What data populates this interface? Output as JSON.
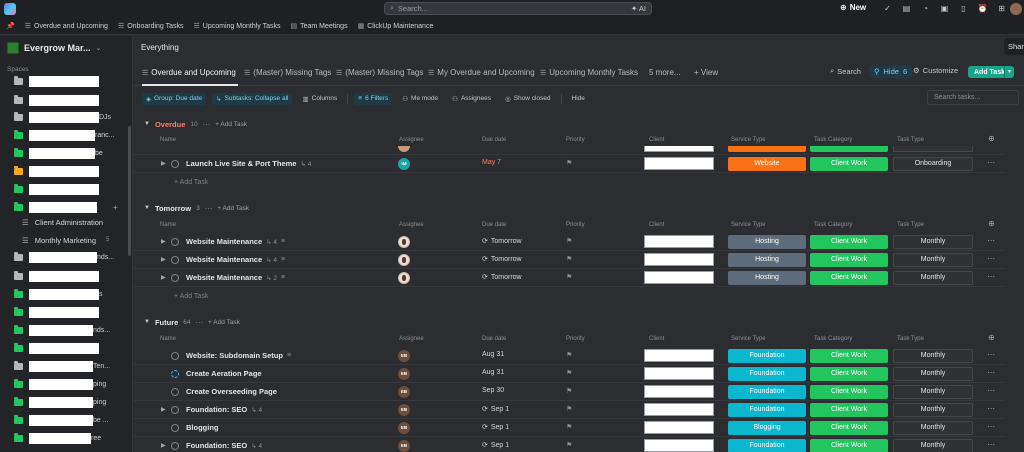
{
  "topbar": {
    "search_placeholder": "Search...",
    "ai_label": "AI",
    "new_label": "New"
  },
  "favorites": [
    {
      "label": "Overdue and Upcoming"
    },
    {
      "label": "Onboarding Tasks"
    },
    {
      "label": "Upcoming Monthly Tasks"
    },
    {
      "label": "Team Meetings"
    },
    {
      "label": "ClickUp Maintenance"
    }
  ],
  "sidebar": {
    "workspace_name": "Evergrow Mar...",
    "spaces_label": "Spaces",
    "items": [
      {
        "tail": ""
      },
      {
        "tail": ""
      },
      {
        "tail": "DJs"
      },
      {
        "tail": "ranc..."
      },
      {
        "tail": "be"
      },
      {
        "tail": ""
      },
      {
        "tail": ""
      },
      {
        "tail": ""
      }
    ],
    "subitems": [
      {
        "label": "Client Administration",
        "count": ""
      },
      {
        "label": "Monthly Marketing",
        "count": "5"
      }
    ],
    "items2": [
      {
        "tail": "nds..."
      },
      {
        "tail": ""
      },
      {
        "tail": "s"
      },
      {
        "tail": ""
      },
      {
        "tail": "nds..."
      },
      {
        "tail": ""
      },
      {
        "tail": "Ten..."
      },
      {
        "tail": "ping"
      },
      {
        "tail": "ping"
      },
      {
        "tail": "be ..."
      },
      {
        "tail": "ree"
      }
    ]
  },
  "main": {
    "breadcrumb": "Everything",
    "share_label": "Shar",
    "tabs": [
      {
        "label": "Overdue and Upcoming"
      },
      {
        "label": "(Master) Missing Tags"
      },
      {
        "label": "(Master) Missing Tags"
      },
      {
        "label": "My Overdue and Upcoming"
      },
      {
        "label": "Upcoming Monthly Tasks"
      },
      {
        "label": "5 more..."
      },
      {
        "label": "+ View"
      }
    ],
    "search_label": "Search",
    "hide_label": "Hide",
    "hide_count": "6",
    "customize_label": "Customize",
    "add_task_label": "Add Task",
    "filters": {
      "group": "Group: Due date",
      "subtasks": "Subtasks: Collapse all",
      "columns": "Columns",
      "filters": "6 Filters",
      "me_mode": "Me mode",
      "assignees": "Assignees",
      "show_closed": "Show closed",
      "hide": "Hide",
      "search_placeholder": "Search tasks..."
    },
    "columns": {
      "name": "Name",
      "assignee": "Assignee",
      "due": "Due date",
      "priority": "Priority",
      "client": "Client",
      "service": "Service Type",
      "category": "Task Category",
      "type": "Task Type"
    },
    "add_task_row": "Add Task",
    "add_task_inline": "Add Task",
    "groups": [
      {
        "name": "Overdue",
        "count": "10",
        "tasks": [
          {
            "name": "Launch Live Site & Port Theme",
            "subcount": "4",
            "assignee": "IM",
            "due": "May 7",
            "service": "Website",
            "category": "Client Work",
            "type": "Onboarding"
          }
        ]
      },
      {
        "name": "Tomorrow",
        "count": "3",
        "tasks": [
          {
            "name": "Website Maintenance",
            "subcount": "4",
            "due": "Tomorrow",
            "service": "Hosting",
            "category": "Client Work",
            "type": "Monthly"
          },
          {
            "name": "Website Maintenance",
            "subcount": "4",
            "due": "Tomorrow",
            "service": "Hosting",
            "category": "Client Work",
            "type": "Monthly"
          },
          {
            "name": "Website Maintenance",
            "subcount": "2",
            "due": "Tomorrow",
            "service": "Hosting",
            "category": "Client Work",
            "type": "Monthly"
          }
        ]
      },
      {
        "name": "Future",
        "count": "64",
        "tasks": [
          {
            "name": "Website: Subdomain Setup",
            "subcount": "",
            "assignee": "EB",
            "due": "Aug 31",
            "service": "Foundation",
            "category": "Client Work",
            "type": "Monthly"
          },
          {
            "name": "Create Aeration Page",
            "subcount": "",
            "assignee": "EB",
            "due": "Aug 31",
            "service": "Foundation",
            "category": "Client Work",
            "type": "Monthly"
          },
          {
            "name": "Create Overseeding Page",
            "subcount": "",
            "assignee": "EB",
            "due": "Sep 30",
            "service": "Foundation",
            "category": "Client Work",
            "type": "Monthly"
          },
          {
            "name": "Foundation: SEO",
            "subcount": "4",
            "assignee": "EB",
            "due": "Sep 1",
            "service": "Foundation",
            "category": "Client Work",
            "type": "Monthly"
          },
          {
            "name": "Blogging",
            "subcount": "",
            "assignee": "EB",
            "due": "Sep 1",
            "service": "Blogging",
            "category": "Client Work",
            "type": "Monthly"
          },
          {
            "name": "Foundation: SEO",
            "subcount": "4",
            "assignee": "EB",
            "due": "Sep 1",
            "service": "Foundation",
            "category": "Client Work",
            "type": "Monthly"
          }
        ]
      }
    ]
  },
  "colors": {
    "website": "#f97316",
    "hosting": "#5e6b7a",
    "foundation": "#0ab7cf",
    "blogging": "#0ab7cf",
    "client_work": "#22c55e",
    "overdue_text": "#f08070",
    "accent": "#18a58a"
  }
}
